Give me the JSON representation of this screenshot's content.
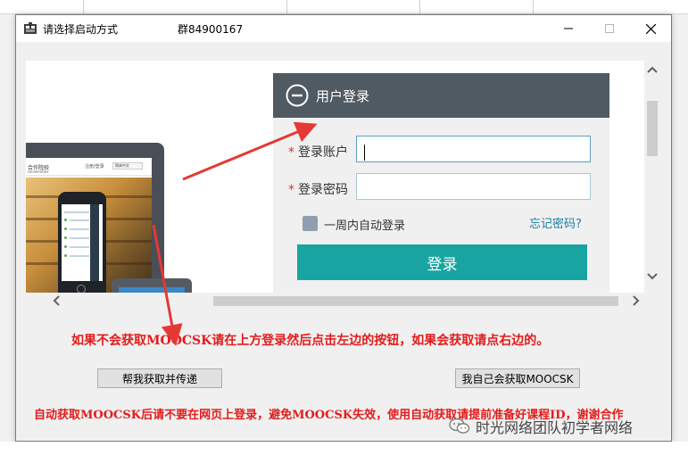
{
  "window": {
    "title": "请选择启动方式",
    "group": "群84900167"
  },
  "device_preview": {
    "brand": "合作院校",
    "brand_sub": "Universities",
    "nav": "注册/登录",
    "lang": "简体中文"
  },
  "login": {
    "title": "用户登录",
    "account_label": "登录账户",
    "password_label": "登录密码",
    "required_mark": "*",
    "account_value": "",
    "password_value": "",
    "remember_label": "一周内自动登录",
    "forgot_label": "忘记密码?",
    "submit_label": "登录"
  },
  "instructions": {
    "line1": "如果不会获取MOOCSK请在上方登录然后点击左边的按钮，如果会获取请点右边的。",
    "line2": "自动获取MOOCSK后请不要在网页上登录，避免MOOCSK失效，使用自动获取请提前准备好课程ID，谢谢合作"
  },
  "buttons": {
    "help": "帮我获取并传递",
    "self": "我自己会获取MOOCSK"
  },
  "watermark": {
    "text": "时光网络团队初学者网络"
  },
  "colors": {
    "login_header": "#4f5a62",
    "login_button": "#18a5a2",
    "instruction_text": "#e31b1b",
    "forgot_link": "#1a7fa3"
  }
}
